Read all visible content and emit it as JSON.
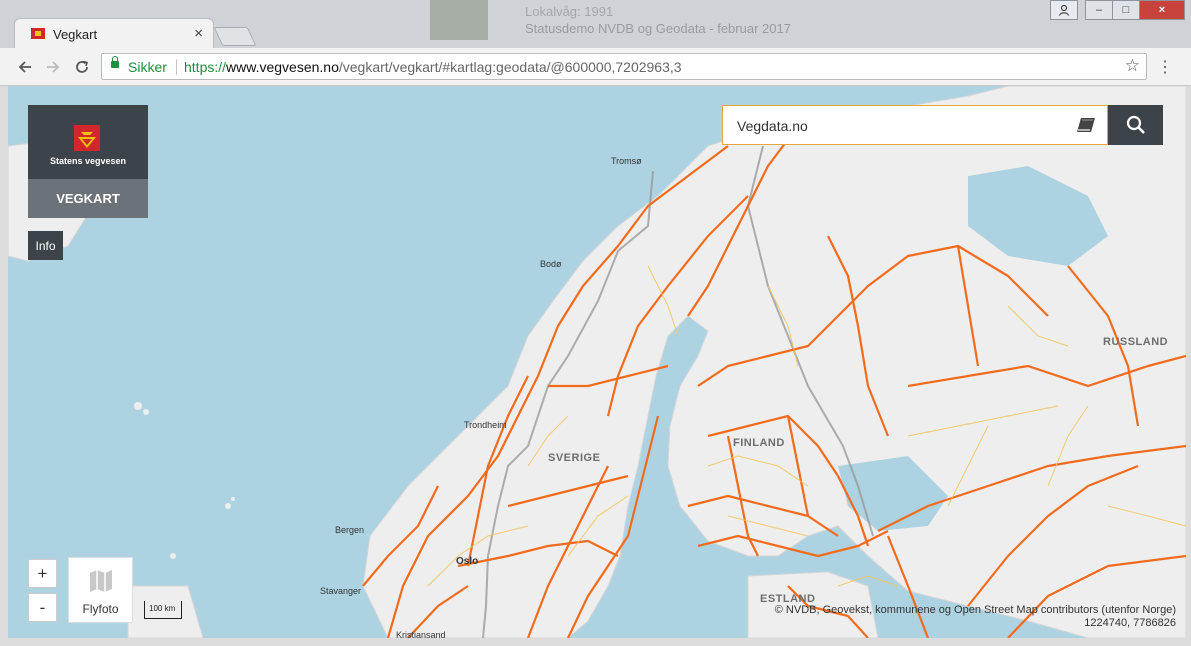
{
  "browser": {
    "tab_title": "Vegkart",
    "tab_close": "×",
    "background_window": {
      "line1": "Lokalvåg: 1991",
      "line2": "Statusdemo NVDB og Geodata - februar 2017"
    },
    "url": {
      "security_label": "Sikker",
      "scheme": "https://",
      "host": "www.vegvesen.no",
      "path": "/vegkart/vegkart/#kartlag:geodata/@600000,7202963,3"
    },
    "icons": {
      "back": "arrow-left-icon",
      "forward": "arrow-right-icon",
      "reload": "reload-icon",
      "bookmark": "star-icon",
      "menu": "kebab-menu-icon"
    },
    "window_controls": {
      "minimize": "–",
      "maximize": "□",
      "close": "×"
    }
  },
  "app": {
    "logo_text": "Statens vegvesen",
    "app_name": "VEGKART",
    "info_label": "Info",
    "search_value": "Vegdata.no",
    "zoom_in_label": "+",
    "zoom_out_label": "-",
    "flyfoto_label": "Flyfoto",
    "scale_label": "100 km",
    "attribution": "© NVDB, Geovekst, kommunene og Open Street Map contributors (utenfor Norge)",
    "coordinates": "1224740, 7786826",
    "colors": {
      "dark_panel": "#3d4449",
      "road": "#f26b1d",
      "water": "#add3e2",
      "land": "#eeeeee",
      "search_border": "#e5a63b"
    }
  },
  "map": {
    "cities": {
      "tromso": "Tromsø",
      "bodo": "Bodø",
      "trondheim": "Trondheim",
      "bergen": "Bergen",
      "oslo": "Oslo",
      "stavanger": "Stavanger",
      "kristiansand": "Kristiansand"
    },
    "countries": {
      "sverige": "SVERIGE",
      "finland": "FINLAND",
      "russland": "RUSSLAND",
      "estland": "ESTLAND"
    }
  }
}
